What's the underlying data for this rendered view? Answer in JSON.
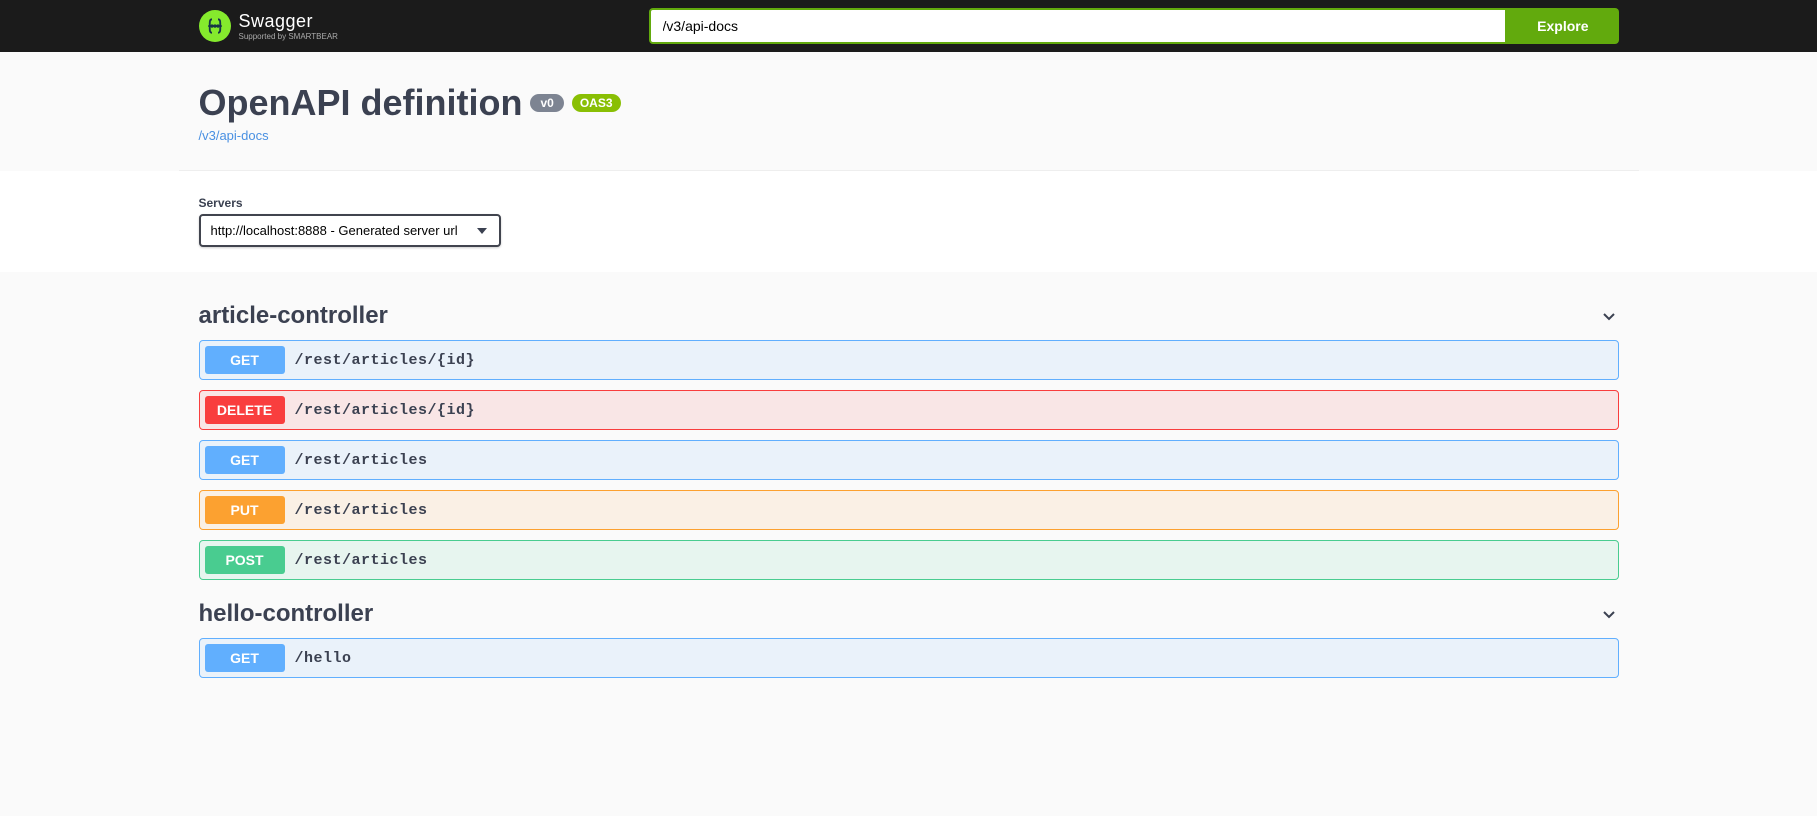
{
  "topbar": {
    "logo_title": "Swagger",
    "logo_subtitle": "Supported by SMARTBEAR",
    "url_value": "/v3/api-docs",
    "explore_label": "Explore"
  },
  "info": {
    "title": "OpenAPI definition",
    "version_badge": "v0",
    "oas_badge": "OAS3",
    "docs_link": "/v3/api-docs"
  },
  "servers": {
    "label": "Servers",
    "selected": "http://localhost:8888 - Generated server url"
  },
  "controllers": [
    {
      "name": "article-controller",
      "operations": [
        {
          "method": "GET",
          "css": "op-get",
          "path": "/rest/articles/{id}"
        },
        {
          "method": "DELETE",
          "css": "op-delete",
          "path": "/rest/articles/{id}"
        },
        {
          "method": "GET",
          "css": "op-get",
          "path": "/rest/articles"
        },
        {
          "method": "PUT",
          "css": "op-put",
          "path": "/rest/articles"
        },
        {
          "method": "POST",
          "css": "op-post",
          "path": "/rest/articles"
        }
      ]
    },
    {
      "name": "hello-controller",
      "operations": [
        {
          "method": "GET",
          "css": "op-get",
          "path": "/hello"
        }
      ]
    }
  ]
}
